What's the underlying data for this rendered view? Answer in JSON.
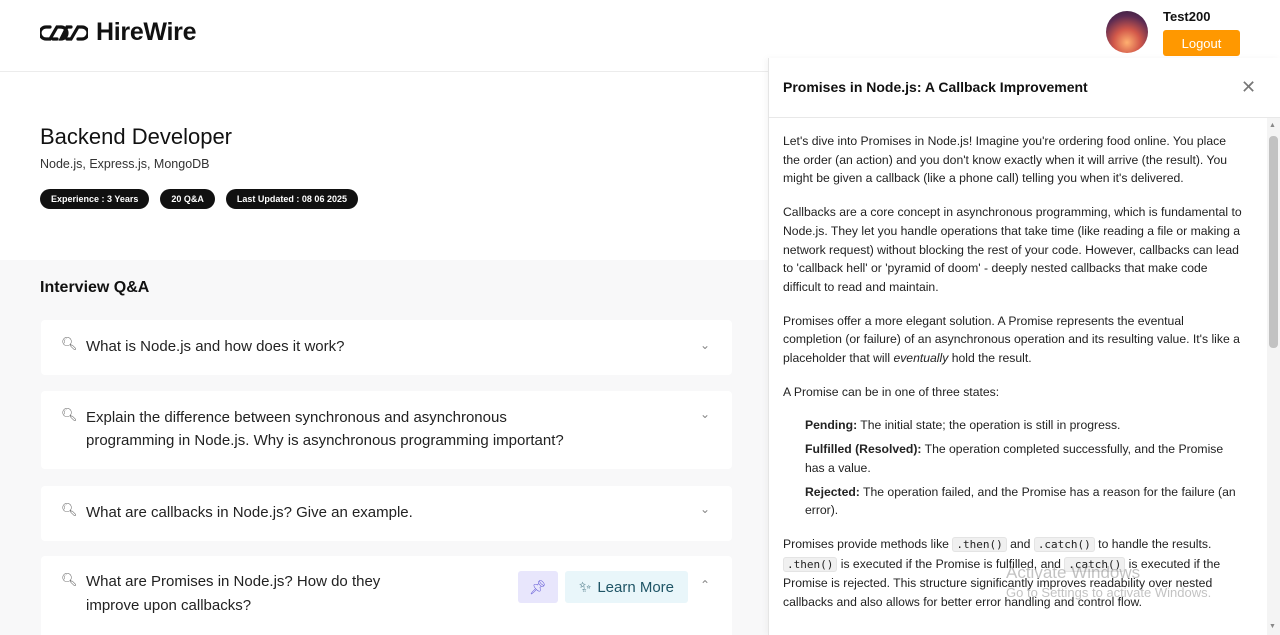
{
  "header": {
    "brand": "HireWire",
    "username": "Test200",
    "logout_label": "Logout"
  },
  "job": {
    "title": "Backend Developer",
    "skills": "Node.js, Express.js, MongoDB",
    "badges": [
      "Experience : 3 Years",
      "20 Q&A",
      "Last Updated : 08 06 2025"
    ]
  },
  "qa": {
    "heading": "Interview Q&A",
    "questions": [
      {
        "line1": "What is Node.js and how does it work?",
        "line2": ""
      },
      {
        "line1": "Explain the difference between synchronous and asynchronous",
        "line2": "programming in Node.js. Why is asynchronous programming important?"
      },
      {
        "line1": "What are callbacks in Node.js? Give an example.",
        "line2": ""
      },
      {
        "line1": "What are Promises in Node.js? How do they",
        "line2": "improve upon callbacks?"
      }
    ],
    "learn_more_label": "Learn More"
  },
  "panel": {
    "title": "Promises in Node.js: A Callback Improvement",
    "p1": "Let's dive into Promises in Node.js! Imagine you're ordering food online. You place the order (an action) and you don't know exactly when it will arrive (the result). You might be given a callback (like a phone call) telling you when it's delivered.",
    "p2": "Callbacks are a core concept in asynchronous programming, which is fundamental to Node.js. They let you handle operations that take time (like reading a file or making a network request) without blocking the rest of your code. However, callbacks can lead to 'callback hell' or 'pyramid of doom' - deeply nested callbacks that make code difficult to read and maintain.",
    "p3_before": "Promises offer a more elegant solution. A Promise represents the eventual completion (or failure) of an asynchronous operation and its resulting value. It's like a placeholder that will ",
    "p3_em": "eventually",
    "p3_after": " hold the result.",
    "p4": "A Promise can be in one of three states:",
    "states": [
      {
        "name": "Pending:",
        "desc": " The initial state; the operation is still in progress."
      },
      {
        "name": "Fulfilled (Resolved):",
        "desc": " The operation completed successfully, and the Promise has a value."
      },
      {
        "name": "Rejected:",
        "desc": " The operation failed, and the Promise has a reason for the failure (an error)."
      }
    ],
    "p5_a": "Promises provide methods like ",
    "code_then": ".then()",
    "p5_b": " and ",
    "code_catch": ".catch()",
    "p5_c": " to handle the results. ",
    "p5_d": " is executed if the Promise is fulfilled, and ",
    "p5_e": " is executed if the Promise is rejected. This structure significantly improves readability over nested callbacks and also allows for better error handling and control flow."
  },
  "watermark": {
    "line1": "Activate Windows",
    "line2": "Go to Settings to activate Windows."
  }
}
